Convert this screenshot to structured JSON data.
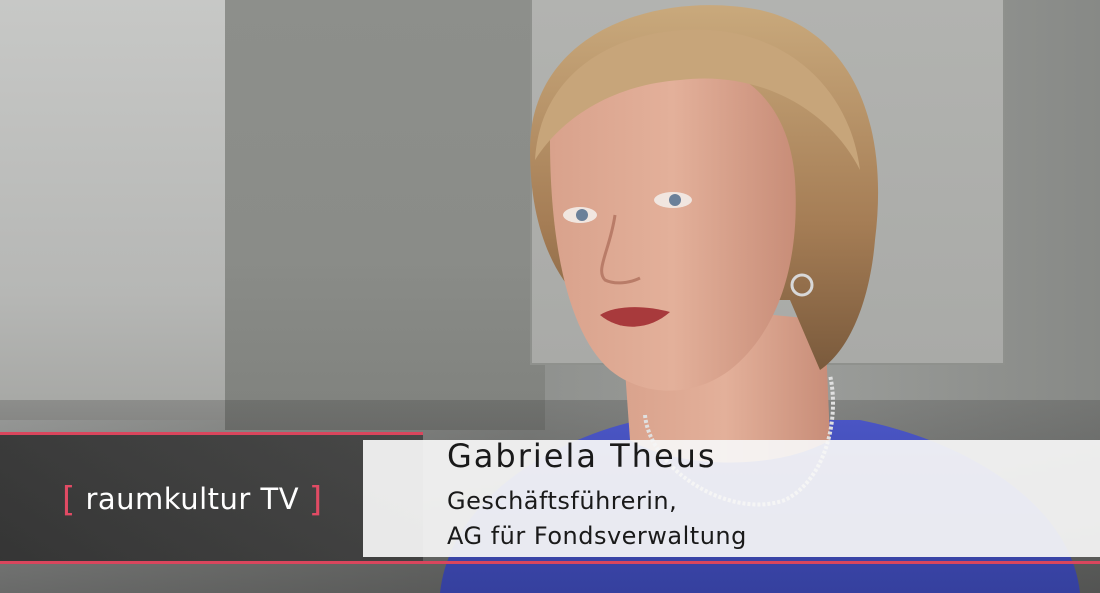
{
  "channel_bug": {
    "bracket_open": "[",
    "label": "raumkultur TV",
    "bracket_close": "]"
  },
  "lower_third": {
    "name": "Gabriela Theus",
    "role_line_1": "Geschäftsführerin,",
    "role_line_2": "AG für Fondsverwaltung"
  },
  "colors": {
    "accent": "#d9465d",
    "lower_third_bg": "#f6f6f6",
    "text_dark": "#1a1a1a",
    "shirt": "#3e48b4"
  }
}
